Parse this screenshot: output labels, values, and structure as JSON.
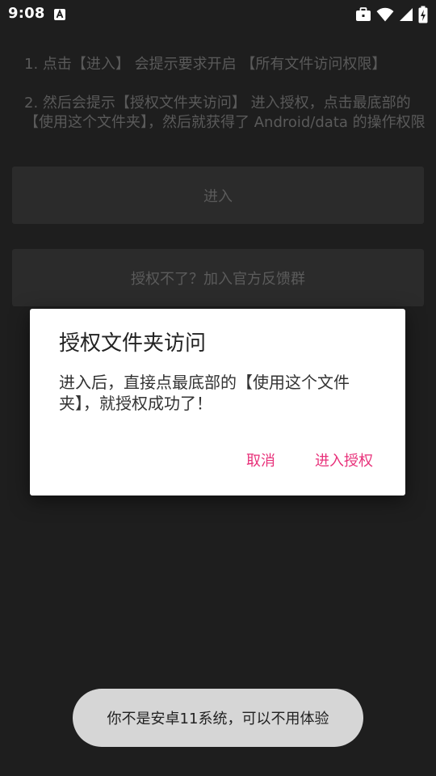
{
  "status_bar": {
    "time": "9:08"
  },
  "background": {
    "instruction_1": "1. 点击【进入】 会提示要求开启 【所有文件访问权限】",
    "instruction_2": "2. 然后会提示【授权文件夹访问】 进入授权，点击最底部的【使用这个文件夹】，然后就获得了 Android/data 的操作权限",
    "enter_button": "进入",
    "feedback_button": "授权不了？加入官方反馈群"
  },
  "dialog": {
    "title": "授权文件夹访问",
    "message": "进入后，直接点最底部的【使用这个文件夹】，就授权成功了！",
    "cancel_label": "取消",
    "confirm_label": "进入授权"
  },
  "toast": {
    "text": "你不是安卓11系统，可以不用体验"
  },
  "colors": {
    "background": "#1e1e1e",
    "accent": "#e8317a",
    "dialog": "#ffffff",
    "toast": "#d6d6d6"
  }
}
